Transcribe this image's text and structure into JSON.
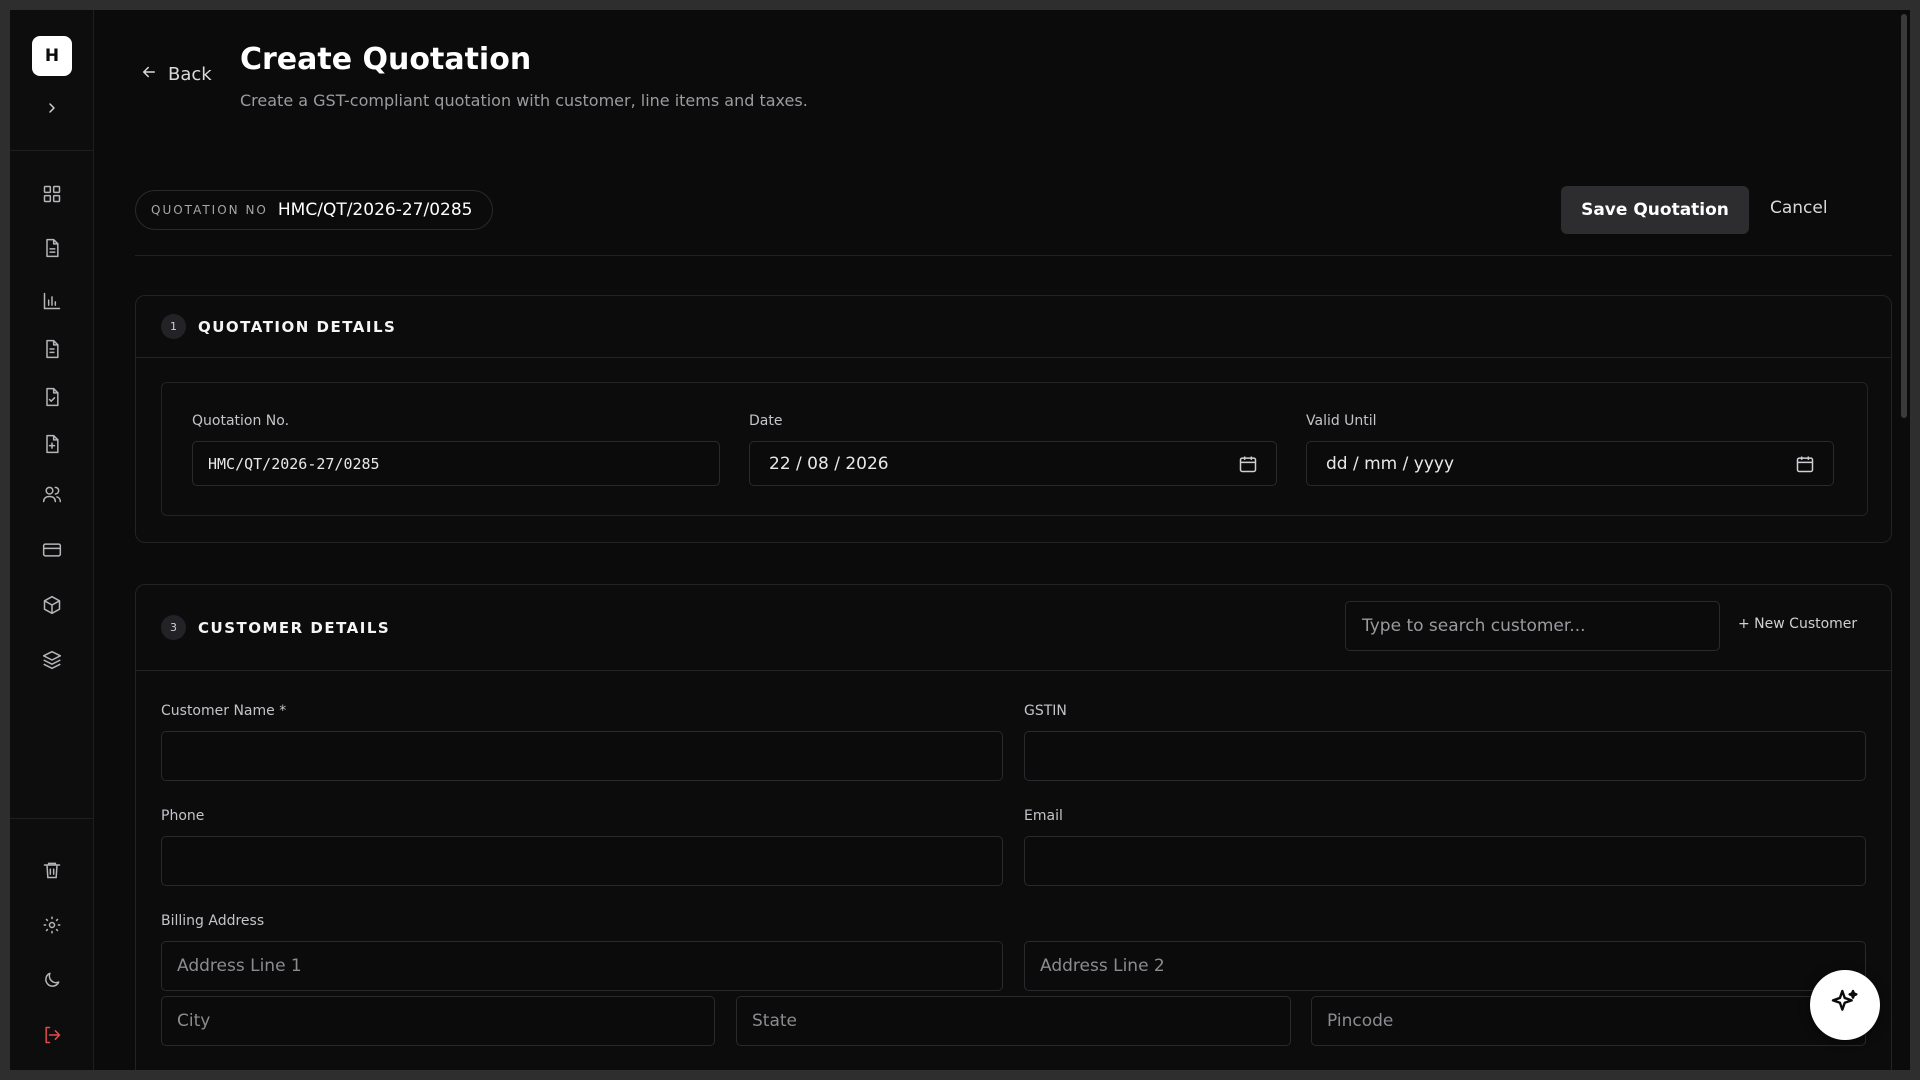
{
  "sidebar": {
    "logo": "H",
    "nav_icons": [
      "dashboard-grid-icon",
      "document-icon",
      "bar-chart-icon",
      "file-text-icon",
      "file-check-icon",
      "file-plus-icon",
      "users-icon",
      "credit-card-icon",
      "package-icon",
      "layers-icon"
    ],
    "bottom_icons": [
      "trash-icon",
      "gear-icon",
      "moon-icon",
      "logout-icon"
    ],
    "logout_color": "#e5484d"
  },
  "header": {
    "back_label": "Back",
    "title": "Create Quotation",
    "subtitle": "Create a GST-compliant quotation with customer, line items and taxes."
  },
  "toolbar": {
    "quotation_no_label": "QUOTATION NO",
    "quotation_no_value": "HMC/QT/2026-27/0285",
    "save_label": "Save Quotation",
    "cancel_label": "Cancel"
  },
  "quotation_details": {
    "step": "1",
    "title": "QUOTATION DETAILS",
    "fields": {
      "quotation_no": {
        "label": "Quotation No.",
        "value": "HMC/QT/2026-27/0285"
      },
      "date": {
        "label": "Date",
        "value": "22 / 08 / 2026"
      },
      "valid_until": {
        "label": "Valid Until",
        "placeholder": "dd / mm / yyyy"
      }
    }
  },
  "customer_details": {
    "step": "3",
    "title": "CUSTOMER DETAILS",
    "search_placeholder": "Type to search customer...",
    "new_customer_label": "+ New Customer",
    "fields": {
      "customer_name": {
        "label": "Customer Name *",
        "value": ""
      },
      "gstin": {
        "label": "GSTIN",
        "value": ""
      },
      "phone": {
        "label": "Phone",
        "value": ""
      },
      "email": {
        "label": "Email",
        "value": ""
      },
      "billing_address": {
        "label": "Billing Address",
        "address_line1_placeholder": "Address Line 1",
        "address_line2_placeholder": "Address Line 2",
        "city_placeholder": "City",
        "state_placeholder": "State",
        "pincode_placeholder": "Pincode"
      }
    }
  },
  "assistant": {
    "icon": "sparkles-icon"
  }
}
